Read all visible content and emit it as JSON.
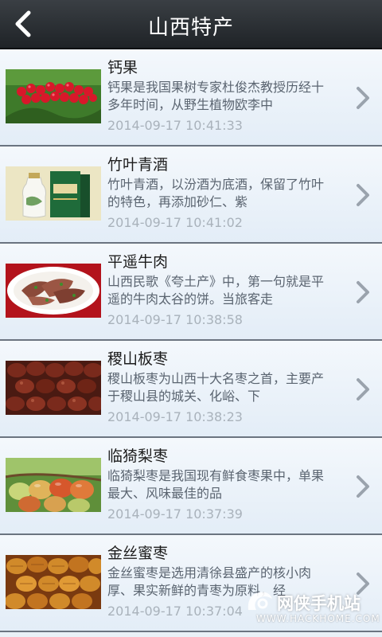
{
  "header": {
    "title": "山西特产"
  },
  "items": [
    {
      "name": "钙果",
      "desc": "钙果是我国果树专家杜俊杰教授历经十多年时间，从野生植物欧李中",
      "time": "2014-09-17 10:41:33",
      "thumb": "cherries-image"
    },
    {
      "name": "竹叶青酒",
      "desc": "竹叶青酒，以汾酒为底酒，保留了竹叶的特色，再添加砂仁、紫",
      "time": "2014-09-17 10:41:02",
      "thumb": "liquor-bottle-image"
    },
    {
      "name": "平遥牛肉",
      "desc": "山西民歌《夸土产》中，第一句就是平遥的牛肉太谷的饼。当旅客走",
      "time": "2014-09-17 10:38:58",
      "thumb": "beef-plate-image"
    },
    {
      "name": "稷山板枣",
      "desc": "稷山板枣为山西十大名枣之首，主要产于稷山县的城关、化峪、下",
      "time": "2014-09-17 10:38:23",
      "thumb": "jujube-image"
    },
    {
      "name": "临猗梨枣",
      "desc": "临猗梨枣是我国现有鲜食枣果中，单果最大、风味最佳的品",
      "time": "2014-09-17 10:37:39",
      "thumb": "pear-jujube-image"
    },
    {
      "name": "金丝蜜枣",
      "desc": "金丝蜜枣是选用清徐县盛产的核小肉厚、果实新鲜的青枣为原料，经",
      "time": "2014-09-17 10:37:04",
      "thumb": "honey-jujube-image"
    }
  ],
  "watermark": {
    "big": "网侠手机站",
    "small": "WWW.HACKHOME.COM"
  },
  "colors": {
    "header_bg": "#2a2e33",
    "item_bg": "#e9f0f7",
    "title_text": "#1d1d1d",
    "desc_text": "#5a6470",
    "time_text": "#a9b2bb",
    "chevron": "#9aa3ad"
  }
}
